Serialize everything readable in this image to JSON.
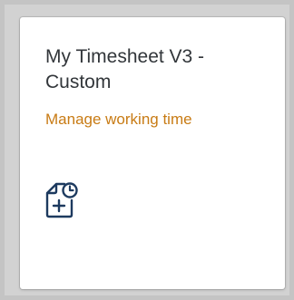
{
  "tile": {
    "title": "My Timesheet V3 - Custom",
    "subtitle": "Manage working time",
    "icon": "timesheet-add-icon"
  },
  "colors": {
    "title": "#32363a",
    "subtitle": "#c87b14",
    "icon": "#1d3a5f",
    "background": "#c4c4c4",
    "tile": "#ffffff"
  }
}
